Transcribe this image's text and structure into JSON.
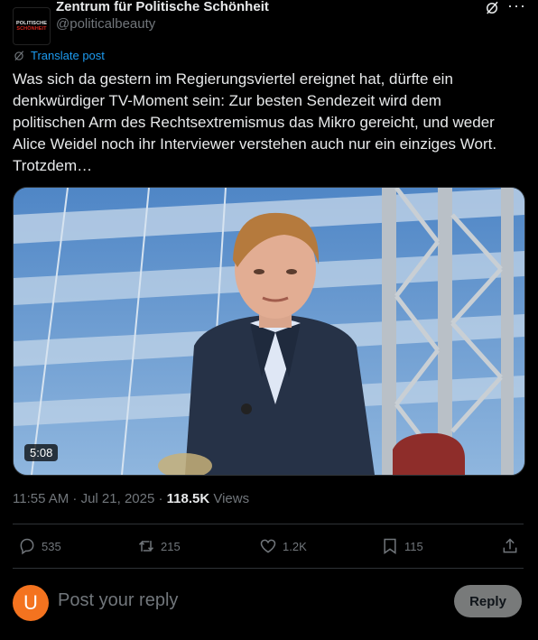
{
  "author": {
    "avatar_text_line1": "POLITISCHE",
    "avatar_text_line2": "SCHÖNHEIT",
    "name": "Zentrum für Politische Schönheit",
    "handle": "@politicalbeauty"
  },
  "translate_label": "Translate post",
  "post_text": "Was sich da gestern im Regierungsviertel ereignet hat, dürfte ein denkwürdiger TV-Moment sein: Zur besten Sendezeit wird dem politischen Arm des Rechtsextremismus das Mikro gereicht, und weder Alice Weidel noch ihr Interviewer verstehen auch nur ein einziges Wort. Trotzdem…",
  "video": {
    "duration": "5:08"
  },
  "meta": {
    "time": "11:55 AM · Jul 21, 2025 · ",
    "views_count": "118.5K",
    "views_label": " Views"
  },
  "actions": {
    "replies": "535",
    "reposts": "215",
    "likes": "1.2K",
    "bookmarks": "115"
  },
  "reply": {
    "avatar_letter": "U",
    "placeholder": "Post your reply",
    "button_label": "Reply"
  },
  "colors": {
    "accent": "#1d9bf0",
    "avatar": "#f4731f",
    "background": "#000000"
  }
}
